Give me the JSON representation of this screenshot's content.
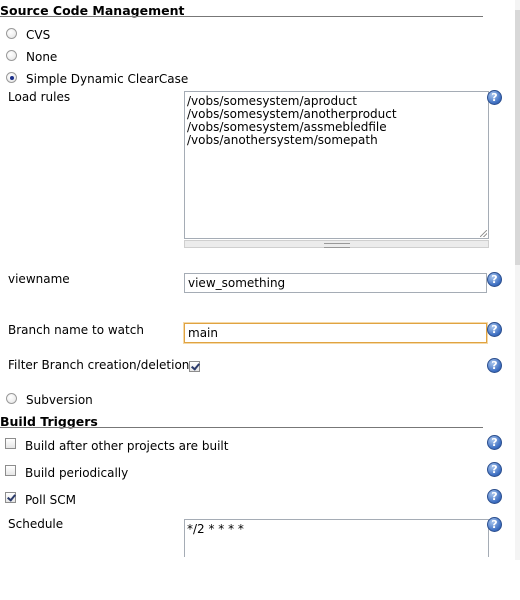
{
  "scm": {
    "title": "Source Code Management",
    "options": [
      {
        "label": "CVS",
        "checked": false
      },
      {
        "label": "None",
        "checked": false
      },
      {
        "label": "Simple Dynamic ClearCase",
        "checked": true
      }
    ],
    "load_rules": {
      "label": "Load rules",
      "lines": [
        "/vobs/somesystem/aproduct",
        "/vobs/somesystem/anotherproduct",
        "/vobs/somesystem/assmebledfile",
        "/vobs/anothersystem/somepath"
      ]
    },
    "viewname": {
      "label": "viewname",
      "value": "view_something"
    },
    "branch": {
      "label": "Branch name to watch",
      "value": "main"
    },
    "filter": {
      "label": "Filter Branch creation/deletion",
      "checked": true
    },
    "subversion": {
      "label": "Subversion",
      "checked": false
    }
  },
  "triggers": {
    "title": "Build Triggers",
    "options": [
      {
        "label": "Build after other projects are built",
        "checked": false
      },
      {
        "label": "Build periodically",
        "checked": false
      },
      {
        "label": "Poll SCM",
        "checked": true
      }
    ],
    "schedule": {
      "label": "Schedule",
      "value": "*/2 * * * *"
    }
  },
  "help_icon": "?",
  "colors": {
    "help_icon": "#3a6cc0",
    "focus_border": "#e0a341",
    "rule": "#777777"
  }
}
